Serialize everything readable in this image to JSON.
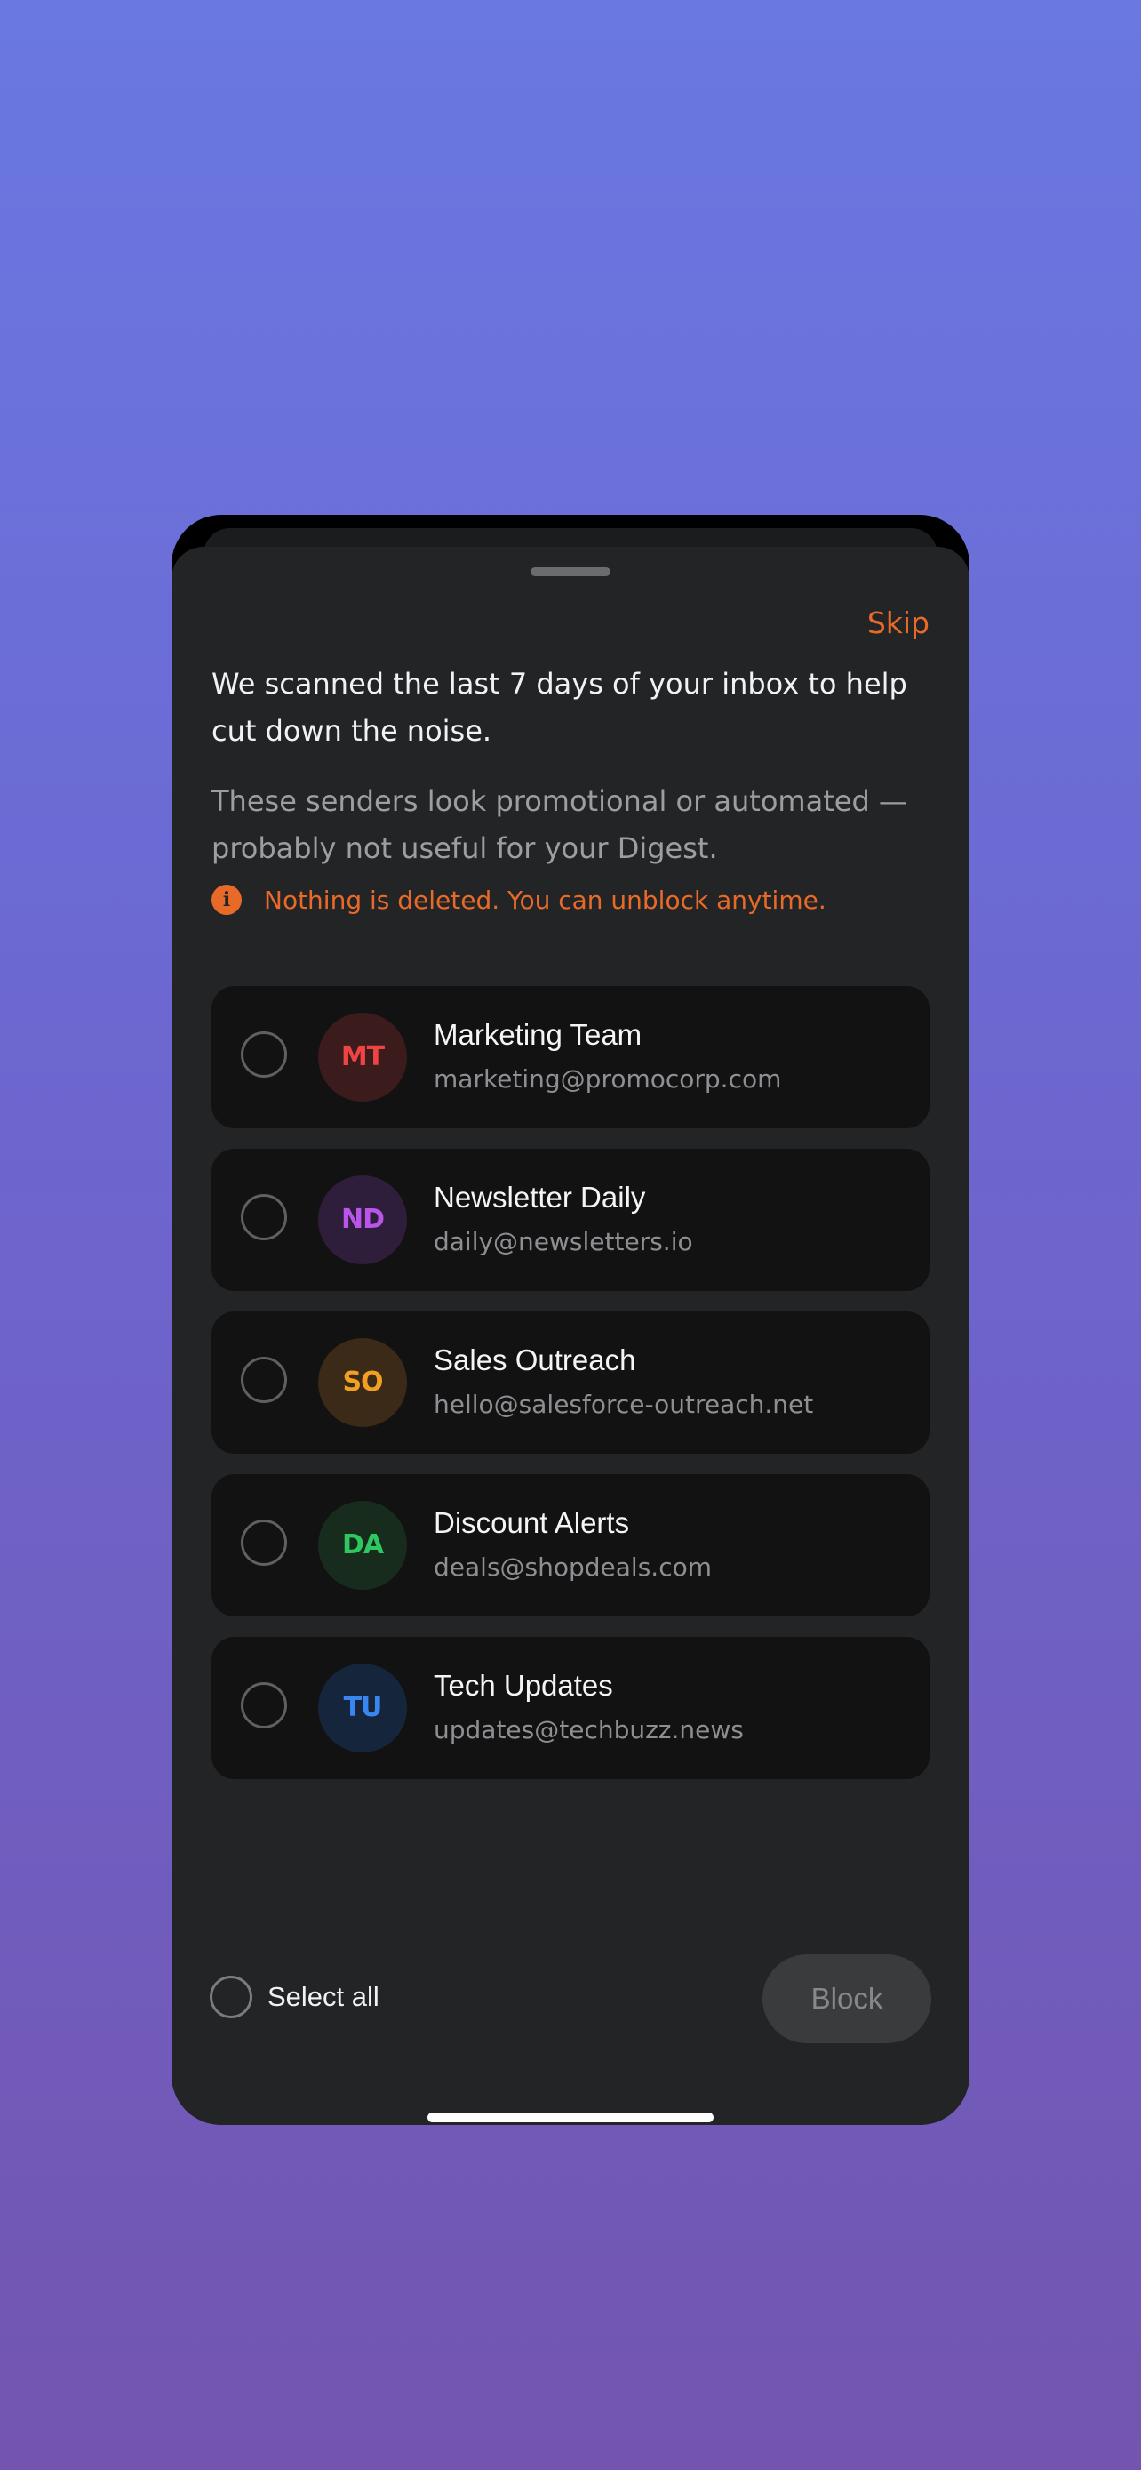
{
  "sheet": {
    "skip_label": "Skip",
    "intro": "We scanned the last 7 days of your inbox to help cut down the noise.",
    "subtext": "These senders look promotional or automated — probably not useful for your Digest.",
    "notice": {
      "icon": "info-icon",
      "icon_glyph": "i",
      "text": "Nothing is deleted. You can unblock anytime."
    }
  },
  "senders": [
    {
      "initials": "MT",
      "name": "Marketing Team",
      "email": "marketing@promocorp.com",
      "selected": false,
      "avatar_bg": "#3b1b1c",
      "avatar_fg": "#ef4444"
    },
    {
      "initials": "ND",
      "name": "Newsletter Daily",
      "email": "daily@newsletters.io",
      "selected": false,
      "avatar_bg": "#2e1d3b",
      "avatar_fg": "#b955e8"
    },
    {
      "initials": "SO",
      "name": "Sales Outreach",
      "email": "hello@salesforce-outreach.net",
      "selected": false,
      "avatar_bg": "#3a2a17",
      "avatar_fg": "#f2a024"
    },
    {
      "initials": "DA",
      "name": "Discount Alerts",
      "email": "deals@shopdeals.com",
      "selected": false,
      "avatar_bg": "#182c1e",
      "avatar_fg": "#2ec760"
    },
    {
      "initials": "TU",
      "name": "Tech Updates",
      "email": "updates@techbuzz.news",
      "selected": false,
      "avatar_bg": "#15253b",
      "avatar_fg": "#3a86f0"
    }
  ],
  "footer": {
    "select_all_label": "Select all",
    "select_all_checked": false,
    "block_label": "Block",
    "block_enabled": false
  },
  "colors": {
    "accent": "#e86a28",
    "sheet_bg": "#232426",
    "card_bg": "#121212"
  }
}
